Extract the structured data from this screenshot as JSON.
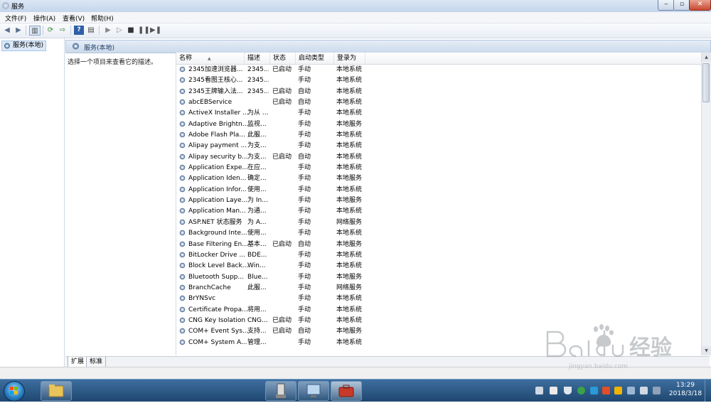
{
  "window": {
    "title": "服务"
  },
  "menu": [
    "文件(F)",
    "操作(A)",
    "查看(V)",
    "帮助(H)"
  ],
  "tree": {
    "root_label": "服务(本地)"
  },
  "pane": {
    "header": "服务(本地)",
    "description": "选择一个项目来查看它的描述。"
  },
  "columns": {
    "name": "名称",
    "desc": "描述",
    "status": "状态",
    "start": "启动类型",
    "logon": "登录为"
  },
  "services": [
    {
      "name": "2345加速浏览器...",
      "desc": "2345...",
      "status": "已启动",
      "start": "手动",
      "logon": "本地系统"
    },
    {
      "name": "2345看图王核心...",
      "desc": "2345...",
      "status": "",
      "start": "手动",
      "logon": "本地系统"
    },
    {
      "name": "2345王牌输入法...",
      "desc": "2345...",
      "status": "已启动",
      "start": "自动",
      "logon": "本地系统"
    },
    {
      "name": "abcEBService",
      "desc": "",
      "status": "已启动",
      "start": "自动",
      "logon": "本地系统"
    },
    {
      "name": "ActiveX Installer ...",
      "desc": "为从 ...",
      "status": "",
      "start": "手动",
      "logon": "本地系统"
    },
    {
      "name": "Adaptive Brightn...",
      "desc": "监视...",
      "status": "",
      "start": "手动",
      "logon": "本地服务"
    },
    {
      "name": "Adobe Flash Pla...",
      "desc": "此服...",
      "status": "",
      "start": "手动",
      "logon": "本地系统"
    },
    {
      "name": "Alipay payment ...",
      "desc": "为支...",
      "status": "",
      "start": "手动",
      "logon": "本地系统"
    },
    {
      "name": "Alipay security b...",
      "desc": "为支...",
      "status": "已启动",
      "start": "自动",
      "logon": "本地系统"
    },
    {
      "name": "Application Expe...",
      "desc": "在应...",
      "status": "",
      "start": "手动",
      "logon": "本地系统"
    },
    {
      "name": "Application Iden...",
      "desc": "确定...",
      "status": "",
      "start": "手动",
      "logon": "本地服务"
    },
    {
      "name": "Application Infor...",
      "desc": "使用...",
      "status": "",
      "start": "手动",
      "logon": "本地系统"
    },
    {
      "name": "Application Laye...",
      "desc": "为 In...",
      "status": "",
      "start": "手动",
      "logon": "本地服务"
    },
    {
      "name": "Application Man...",
      "desc": "为通...",
      "status": "",
      "start": "手动",
      "logon": "本地系统"
    },
    {
      "name": "ASP.NET 状态服务",
      "desc": "为 A...",
      "status": "",
      "start": "手动",
      "logon": "网络服务"
    },
    {
      "name": "Background Inte...",
      "desc": "使用...",
      "status": "",
      "start": "手动",
      "logon": "本地系统"
    },
    {
      "name": "Base Filtering En...",
      "desc": "基本...",
      "status": "已启动",
      "start": "自动",
      "logon": "本地服务"
    },
    {
      "name": "BitLocker Drive ...",
      "desc": "BDE...",
      "status": "",
      "start": "手动",
      "logon": "本地系统"
    },
    {
      "name": "Block Level Back...",
      "desc": "Win...",
      "status": "",
      "start": "手动",
      "logon": "本地系统"
    },
    {
      "name": "Bluetooth Supp...",
      "desc": "Blue...",
      "status": "",
      "start": "手动",
      "logon": "本地服务"
    },
    {
      "name": "BranchCache",
      "desc": "此服...",
      "status": "",
      "start": "手动",
      "logon": "网络服务"
    },
    {
      "name": "BrYNSvc",
      "desc": "",
      "status": "",
      "start": "手动",
      "logon": "本地系统"
    },
    {
      "name": "Certificate Propa...",
      "desc": "将用...",
      "status": "",
      "start": "手动",
      "logon": "本地系统"
    },
    {
      "name": "CNG Key Isolation",
      "desc": "CNG...",
      "status": "已启动",
      "start": "手动",
      "logon": "本地系统"
    },
    {
      "name": "COM+ Event Sys...",
      "desc": "支持...",
      "status": "已启动",
      "start": "自动",
      "logon": "本地服务"
    },
    {
      "name": "COM+ System A...",
      "desc": "管理...",
      "status": "",
      "start": "手动",
      "logon": "本地系统"
    }
  ],
  "tabs": [
    "扩展",
    "标准"
  ],
  "clock": {
    "time": "13:29",
    "date": "2018/3/18"
  },
  "watermark": {
    "text": "jingyan.baidu.com"
  }
}
